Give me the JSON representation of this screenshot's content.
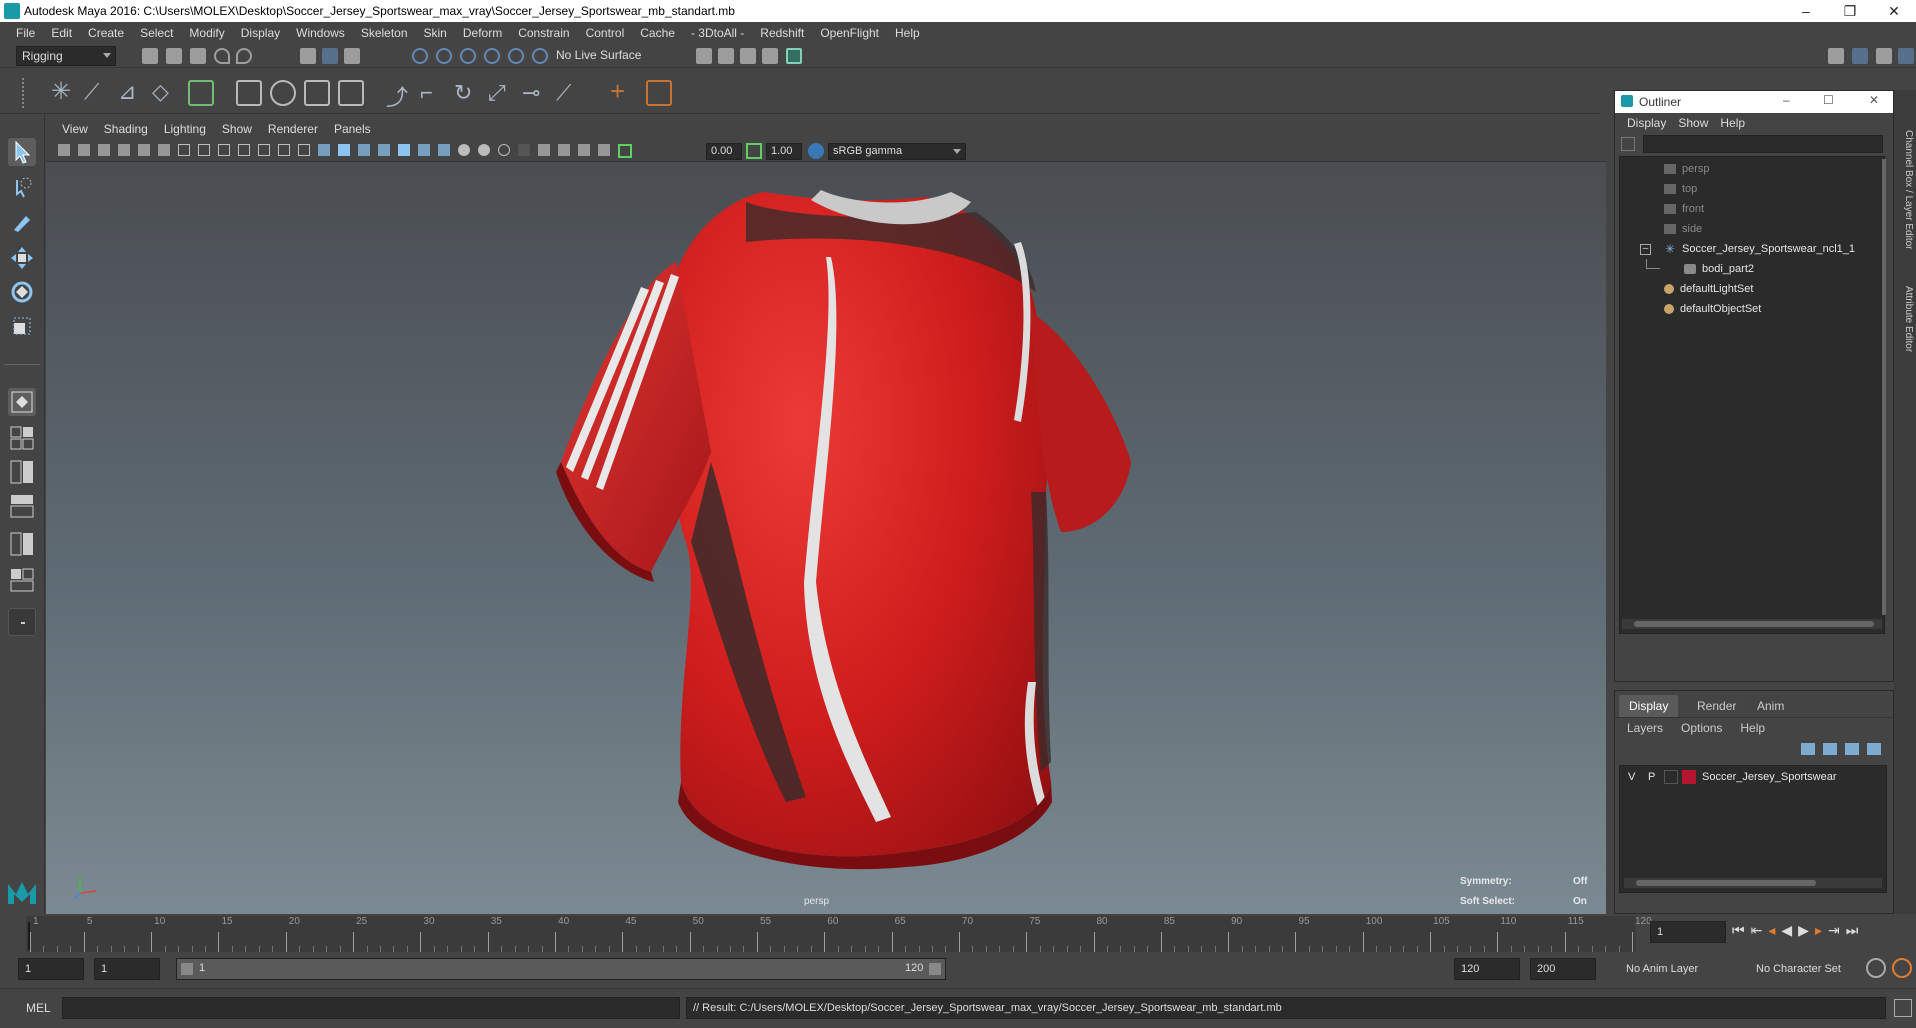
{
  "window": {
    "title": "Autodesk Maya 2016: C:\\Users\\MOLEX\\Desktop\\Soccer_Jersey_Sportswear_max_vray\\Soccer_Jersey_Sportswear_mb_standart.mb",
    "minimize": "–",
    "maximize": "❐",
    "close": "✕"
  },
  "menubar": [
    "File",
    "Edit",
    "Create",
    "Select",
    "Modify",
    "Display",
    "Windows",
    "Skeleton",
    "Skin",
    "Deform",
    "Constrain",
    "Control",
    "Cache",
    "- 3DtoAll -",
    "Redshift",
    "OpenFlight",
    "Help"
  ],
  "statusline": {
    "menuset": "Rigging",
    "live_surface": "No Live Surface"
  },
  "viewport": {
    "menu": [
      "View",
      "Shading",
      "Lighting",
      "Show",
      "Renderer",
      "Panels"
    ],
    "exposure": "0.00",
    "gamma": "1.00",
    "colorspace": "sRGB gamma",
    "camera_label": "persp",
    "hud": {
      "symmetry_label": "Symmetry:",
      "symmetry_value": "Off",
      "soft_select_label": "Soft Select:",
      "soft_select_value": "On"
    }
  },
  "outliner": {
    "title": "Outliner",
    "menu": [
      "Display",
      "Show",
      "Help"
    ],
    "items": [
      {
        "label": "persp",
        "icon": "camera-icon"
      },
      {
        "label": "top",
        "icon": "camera-icon"
      },
      {
        "label": "front",
        "icon": "camera-icon"
      },
      {
        "label": "side",
        "icon": "camera-icon"
      },
      {
        "label": "Soccer_Jersey_Sportswear_ncl1_1",
        "icon": "nucleus-icon"
      },
      {
        "label": "bodi_part2",
        "icon": "mesh-icon"
      },
      {
        "label": "defaultLightSet",
        "icon": "set-icon"
      },
      {
        "label": "defaultObjectSet",
        "icon": "set-icon"
      }
    ]
  },
  "side_tabs": {
    "channel_box": "Channel Box / Layer Editor",
    "attribute_editor": "Attribute Editor"
  },
  "layers": {
    "tabs": [
      "Display",
      "Render",
      "Anim"
    ],
    "menu": [
      "Layers",
      "Options",
      "Help"
    ],
    "layer": {
      "visible": "V",
      "playback": "P",
      "name": "Soccer_Jersey_Sportswear",
      "color": "#b5162f"
    }
  },
  "timeline": {
    "ticks": [
      "1",
      "5",
      "10",
      "15",
      "20",
      "25",
      "30",
      "35",
      "40",
      "45",
      "50",
      "55",
      "60",
      "65",
      "70",
      "75",
      "80",
      "85",
      "90",
      "95",
      "100",
      "105",
      "110",
      "115",
      "120"
    ],
    "current_frame": "1"
  },
  "range": {
    "start": "1",
    "playback_start": "1",
    "slider_start": "1",
    "slider_end": "120",
    "playback_end": "120",
    "end": "200",
    "anim_layer": "No Anim Layer",
    "character_set": "No Character Set"
  },
  "cmdline": {
    "lang": "MEL",
    "result": "// Result: C:/Users/MOLEX/Desktop/Soccer_Jersey_Sportswear_max_vray/Soccer_Jersey_Sportswear_mb_standart.mb"
  },
  "colors": {
    "jersey": "#d21f1f",
    "accent": "#1a9aa8"
  }
}
